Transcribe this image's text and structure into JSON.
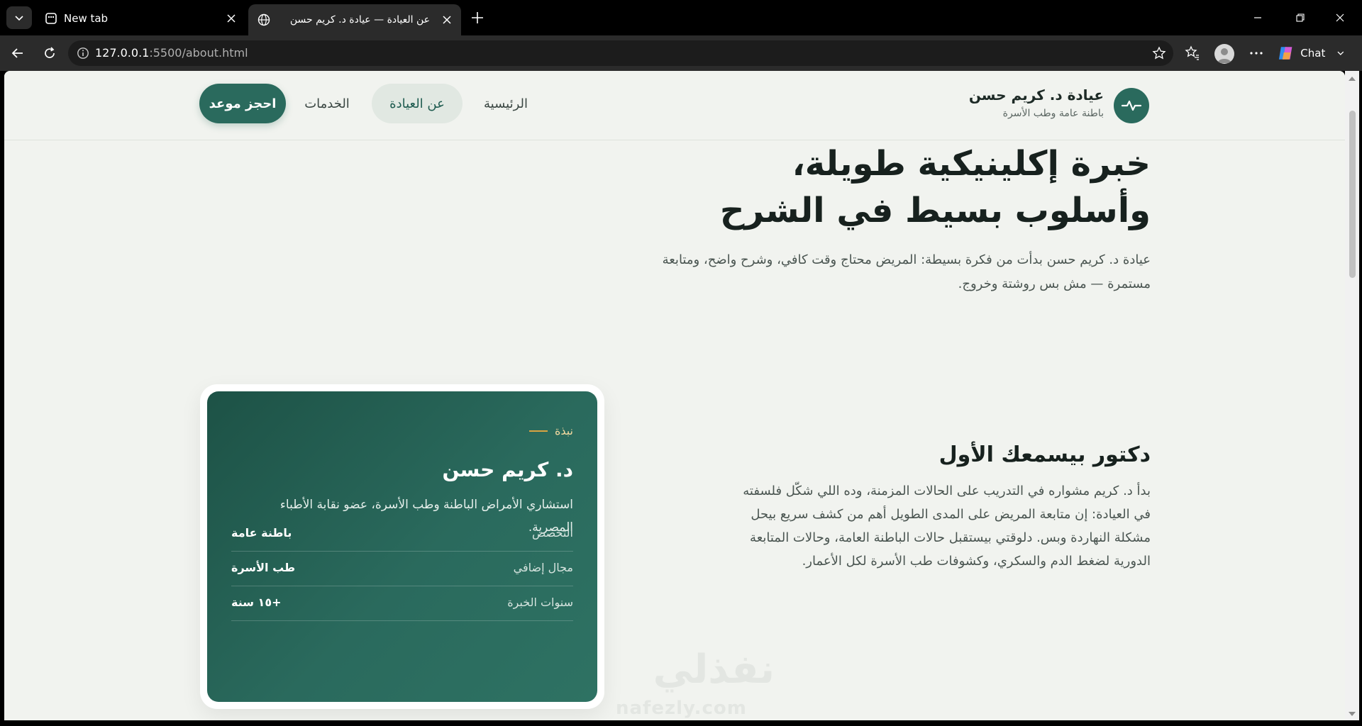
{
  "browser": {
    "tabs": [
      {
        "title": "New tab"
      },
      {
        "title": "عن العيادة — عيادة د. كريم حسن"
      }
    ],
    "url_host": "127.0.0.1",
    "url_rest": ":5500/about.html",
    "chat_label": "Chat"
  },
  "site": {
    "brand_name": "عيادة د. كريم حسن",
    "brand_tagline": "باطنة عامة وطب الأسرة",
    "nav": {
      "home": "الرئيسية",
      "about": "عن العيادة",
      "services": "الخدمات",
      "cta": "احجز موعد"
    },
    "hero": {
      "title_line1": "خبرة إكلينيكية طويلة،",
      "title_line2": "وأسلوب بسيط في الشرح",
      "subtitle": "عيادة د. كريم حسن بدأت من فكرة بسيطة: المريض محتاج وقت كافي، وشرح واضح، ومتابعة مستمرة — مش بس روشتة وخروج."
    },
    "profile_card": {
      "eyebrow": "نبذة",
      "name": "د. كريم حسن",
      "description": "استشاري الأمراض الباطنة وطب الأسرة، عضو نقابة الأطباء المصرية.",
      "rows": [
        {
          "label": "التخصص",
          "value": "باطنة عامة"
        },
        {
          "label": "مجال إضافي",
          "value": "طب الأسرة"
        },
        {
          "label": "سنوات الخبرة",
          "value": "+١٥ سنة"
        }
      ]
    },
    "story": {
      "title": "دكتور بيسمعك الأول",
      "body": "بدأ د. كريم مشواره في التدريب على الحالات المزمنة، وده اللي شكّل فلسفته في العيادة: إن متابعة المريض على المدى الطويل أهم من كشف سريع بيحل مشكلة النهاردة وبس. دلوقتي بيستقبل حالات الباطنة العامة، وحالات المتابعة الدورية لضغط الدم والسكري، وكشوفات طب الأسرة لكل الأعمار."
    }
  },
  "watermark": {
    "arabic": "نفذلي",
    "latin": "nafezly.com"
  },
  "colors": {
    "brand": "#2a6a5d",
    "accent_gold": "#d9a441",
    "page_bg": "#f1f3ef"
  },
  "icons": {
    "brand": "heartbeat-icon"
  }
}
